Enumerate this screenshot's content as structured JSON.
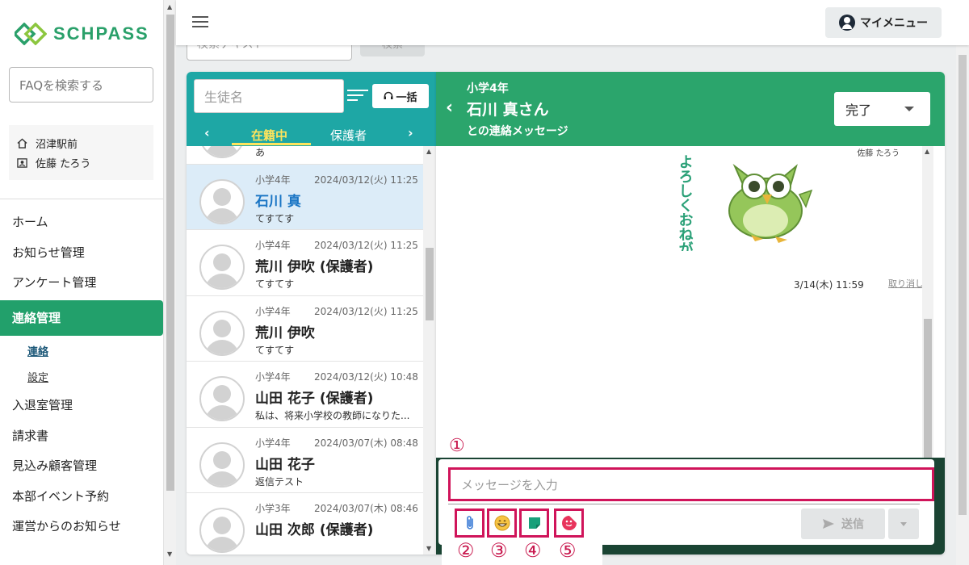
{
  "app": {
    "logo_text": "SCHPASS",
    "brand_color": "#2aa06a"
  },
  "sidebar": {
    "faq_placeholder": "FAQを検索する",
    "school": "沼津駅前",
    "user": "佐藤 たろう",
    "nav": [
      {
        "label": "ホーム"
      },
      {
        "label": "お知らせ管理"
      },
      {
        "label": "アンケート管理"
      },
      {
        "label": "連絡管理",
        "active": true
      },
      {
        "label": "連絡",
        "sub": true,
        "current": true
      },
      {
        "label": "設定",
        "sub": true
      },
      {
        "label": "入退室管理"
      },
      {
        "label": "請求書"
      },
      {
        "label": "見込み顧客管理"
      },
      {
        "label": "本部イベント予約"
      },
      {
        "label": "運営からのお知らせ"
      }
    ]
  },
  "header": {
    "mymenu_label": "マイメニュー",
    "search_placeholder": "検索テキスト",
    "search_button": "検索"
  },
  "student_list": {
    "name_placeholder": "生徒名",
    "bulk_label": "一括",
    "tabs": [
      "在籍中",
      "保護者"
    ],
    "partial_top_msg": "あ",
    "items": [
      {
        "grade": "小学4年",
        "date": "2024/03/12(火) 11:25",
        "name": "石川 真",
        "msg": "てすてす",
        "selected": true
      },
      {
        "grade": "小学4年",
        "date": "2024/03/12(火) 11:25",
        "name": "荒川 伊吹 (保護者)",
        "msg": "てすてす"
      },
      {
        "grade": "小学4年",
        "date": "2024/03/12(火) 11:25",
        "name": "荒川 伊吹",
        "msg": "てすてす"
      },
      {
        "grade": "小学4年",
        "date": "2024/03/12(火) 10:48",
        "name": "山田 花子 (保護者)",
        "msg": "私は、将来小学校の教師になりた..."
      },
      {
        "grade": "小学4年",
        "date": "2024/03/07(木) 08:48",
        "name": "山田 花子",
        "msg": "返信テスト"
      },
      {
        "grade": "小学3年",
        "date": "2024/03/07(木) 08:46",
        "name": "山田 次郎 (保護者)",
        "msg": ""
      }
    ]
  },
  "chat": {
    "grade": "小学4年",
    "name": "石川 真さん",
    "subtitle": "との連絡メッセージ",
    "status": "完了",
    "sender": "佐藤 たろう",
    "sticker_text": "よろしくおねがいします",
    "timestamp": "3/14(木) 11:59",
    "undo_label": "取り消し",
    "input_placeholder": "メッセージを入力",
    "send_label": "送信"
  },
  "annotations": {
    "input_marker": "①",
    "tool_markers": [
      "②",
      "③",
      "④",
      "⑤"
    ],
    "highlight_color": "#d0145a"
  }
}
